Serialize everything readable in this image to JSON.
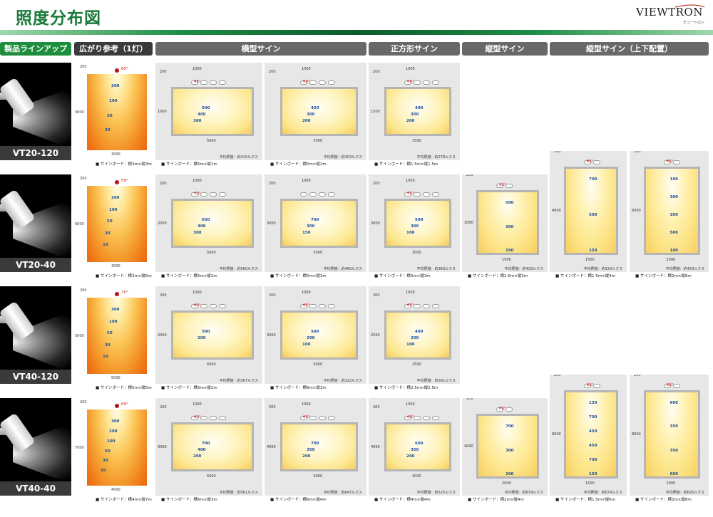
{
  "page": {
    "title": "照度分布図",
    "logo": "VIEWTRON",
    "logo_sub": "ビュートロン"
  },
  "headers": [
    "製品ラインアップ",
    "広がり参考（1灯）",
    "横型サイン",
    "正方形サイン",
    "縦型サイン",
    "縦型サイン（上下配置）"
  ],
  "colors": {
    "brand_green": "#1d8d3e",
    "spread_orange": "#ee6f12",
    "board_yellow": "#fde58a"
  },
  "rows": [
    {
      "model": "VT20-120",
      "cells": [
        {
          "kind": "spread",
          "w": "3000",
          "h": "3000",
          "top": "200",
          "angle": "65°",
          "iso": [
            "200",
            "100",
            "50",
            "30"
          ],
          "caption": "■ サインボード：横3m×縦3m"
        },
        {
          "kind": "board",
          "w": "5000",
          "h": "1000",
          "top": "200",
          "span": "1000",
          "angle": "45°",
          "iso": [
            "500",
            "400",
            "300"
          ],
          "avg": "平均照度：約410ルクス",
          "caption": "■ サインボード：横5m×縦1m"
        },
        {
          "kind": "board",
          "w": "5000",
          "h": "",
          "top": "200",
          "span": "1000",
          "angle": "60°",
          "iso": [
            "450",
            "300",
            "200"
          ],
          "avg": "平均照度：約303ルクス",
          "caption": "■ サインボード：横5m×縦2m"
        },
        {
          "kind": "board",
          "w": "1500",
          "h": "1500",
          "top": "200",
          "span": "1000",
          "angle": "60°",
          "iso": [
            "400",
            "300",
            "200"
          ],
          "avg": "平均照度：約278ルクス",
          "caption": "■ サインボード：横1.5m×縦1.5m"
        },
        null,
        null
      ]
    },
    {
      "model": "VT20-40",
      "cells": [
        {
          "kind": "spread",
          "w": "3000",
          "h": "6000",
          "top": "200",
          "angle": "59°",
          "iso": [
            "200",
            "100",
            "50",
            "30",
            "10"
          ],
          "caption": "■ サインボード：横3m×縦6m"
        },
        {
          "kind": "board",
          "w": "5000",
          "h": "2000",
          "top": "200",
          "span": "1000",
          "angle": "50°",
          "iso": [
            "650",
            "400",
            "300"
          ],
          "avg": "平均照度：約560ルクス",
          "caption": "■ サインボード：横5m×縦2m"
        },
        {
          "kind": "board",
          "w": "5000",
          "h": "3000",
          "top": "200",
          "span": "1000",
          "angle": "",
          "iso": [
            "700",
            "300",
            "150"
          ],
          "avg": "平均照度：約460ルクス",
          "caption": "■ サインボード：横5m×縦3m"
        },
        {
          "kind": "board",
          "w": "3000",
          "h": "3000",
          "top": "200",
          "span": "1000",
          "angle": "55°",
          "iso": [
            "500",
            "300",
            "100"
          ],
          "avg": "平均照度：約363ルクス",
          "caption": "■ サインボード：横3m×縦3m"
        },
        {
          "kind": "board",
          "w": "1500",
          "h": "3000",
          "top": "200",
          "span": "1000",
          "angle": "55°",
          "iso": [
            "500",
            "300",
            "100"
          ],
          "avg": "平均照度：約433ルクス",
          "caption": "■ サインボード：横1.5m×縦3m"
        },
        {
          "kind": "pair",
          "a": {
            "w": "1500",
            "h": "4000",
            "top": "200",
            "span": "1000",
            "angle": "65°",
            "iso": [
              "700",
              "500",
              "150"
            ],
            "avg": "平均照度：約520ルクス",
            "caption": "■ サインボード：横1.5m×縦4m"
          },
          "b": {
            "w": "2000",
            "h": "6000",
            "top": "200",
            "span": "1000",
            "angle": "65°",
            "iso": [
              "100",
              "300",
              "300",
              "500",
              "100"
            ],
            "avg": "平均照度：約433ルクス",
            "caption": "■ サインボード：横2m×縦6m"
          }
        }
      ]
    },
    {
      "model": "VT40-120",
      "cells": [
        {
          "kind": "spread",
          "w": "5000",
          "h": "5000",
          "top": "200",
          "angle": "70°",
          "iso": [
            "300",
            "100",
            "50",
            "30",
            "10"
          ],
          "caption": "■ サインボード：横5m×縦5m"
        },
        {
          "kind": "board",
          "w": "6000",
          "h": "2000",
          "top": "200",
          "span": "1000",
          "angle": "60°",
          "iso": [
            "500",
            "200"
          ],
          "avg": "平均照度：約367ルクス",
          "caption": "■ サインボード：横6m×縦2m"
        },
        {
          "kind": "board",
          "w": "6000",
          "h": "3000",
          "top": "200",
          "span": "1000",
          "angle": "65°",
          "iso": [
            "500",
            "200",
            "100"
          ],
          "avg": "平均照度：約322ルクス",
          "caption": "■ サインボード：横6m×縦3m"
        },
        {
          "kind": "board",
          "w": "2500",
          "h": "2500",
          "top": "200",
          "span": "1000",
          "angle": "65°",
          "iso": [
            "400",
            "200",
            "100"
          ],
          "avg": "平均照度：約301ルクス",
          "caption": "■ サインボード：横2.5m×縦2.5m"
        },
        null,
        null
      ]
    },
    {
      "model": "VT40-40",
      "cells": [
        {
          "kind": "spread",
          "w": "4000",
          "h": "7000",
          "top": "200",
          "angle": "69°",
          "iso": [
            "300",
            "200",
            "100",
            "50",
            "30",
            "10"
          ],
          "caption": "■ サインボード：横4m×縦7m"
        },
        {
          "kind": "board",
          "w": "6000",
          "h": "3000",
          "top": "200",
          "span": "1000",
          "angle": "60°",
          "iso": [
            "700",
            "400",
            "200"
          ],
          "avg": "平均照度：約561ルクス",
          "caption": "■ サインボード：横6m×縦3m"
        },
        {
          "kind": "board",
          "w": "6000",
          "h": "4000",
          "top": "200",
          "span": "1000",
          "angle": "60°",
          "iso": [
            "700",
            "350",
            "200"
          ],
          "avg": "平均照度：約647ルクス",
          "caption": "■ サインボード：横6m×縦4m"
        },
        {
          "kind": "board",
          "w": "4000",
          "h": "4000",
          "top": "200",
          "span": "1000",
          "angle": "60°",
          "iso": [
            "600",
            "350",
            "200"
          ],
          "avg": "平均照度：約525ルクス",
          "caption": "■ サインボード：横4m×縦4m"
        },
        {
          "kind": "board",
          "w": "2000",
          "h": "4000",
          "top": "200",
          "span": "1000",
          "angle": "60°",
          "iso": [
            "700",
            "300",
            "200"
          ],
          "avg": "平均照度：約679ルクス",
          "caption": "■ サインボード：横2m×縦4m"
        },
        {
          "kind": "pair",
          "a": {
            "w": "1500",
            "h": "6000",
            "top": "200",
            "span": "1000",
            "angle": "65°",
            "iso": [
              "150",
              "700",
              "450",
              "450",
              "700",
              "150"
            ],
            "avg": "平均照度：約674ルクス",
            "caption": "■ サインボード：横1.5m×縦6m"
          },
          "b": {
            "w": "2000",
            "h": "8000",
            "top": "200",
            "span": "1000",
            "angle": "65°",
            "iso": [
              "600",
              "350",
              "350",
              "600"
            ],
            "avg": "平均照度：約626ルクス",
            "caption": "■ サインボード：横2m×縦8m"
          }
        }
      ]
    }
  ]
}
